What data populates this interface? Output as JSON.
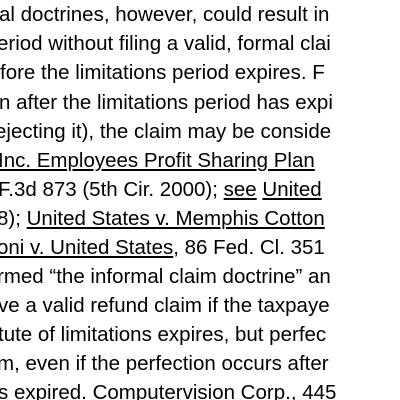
{
  "lines": [
    {
      "text": "al doctrines, however, could result in"
    },
    {
      "text": "eriod without filing a valid, formal clai"
    },
    {
      "text": "fore the limitations period expires.  F"
    },
    {
      "text": "n after the limitations period has expi"
    },
    {
      "text": "ejecting it), the claim may be conside"
    },
    {
      "u1": " Inc. Employees Profit Sharing Plan"
    },
    {
      "t1": "F.3d 873 (5th Cir. 2000); ",
      "u1": "see",
      "t2": " ",
      "u2": "United"
    },
    {
      "t1": "8); ",
      "u1": "United States v. Memphis Cotton"
    },
    {
      "u1": "oni v. United States",
      "t1": ", 86 Fed. Cl. 351"
    },
    {
      "text": "rmed “the informal claim doctrine” an"
    },
    {
      "text": "ve a valid refund claim if the taxpaye"
    },
    {
      "text": "tute of limitations expires, but perfec"
    },
    {
      "text": "m, even if the perfection occurs after"
    },
    {
      "text": "s expired.  Computervision Corp., 445"
    }
  ]
}
